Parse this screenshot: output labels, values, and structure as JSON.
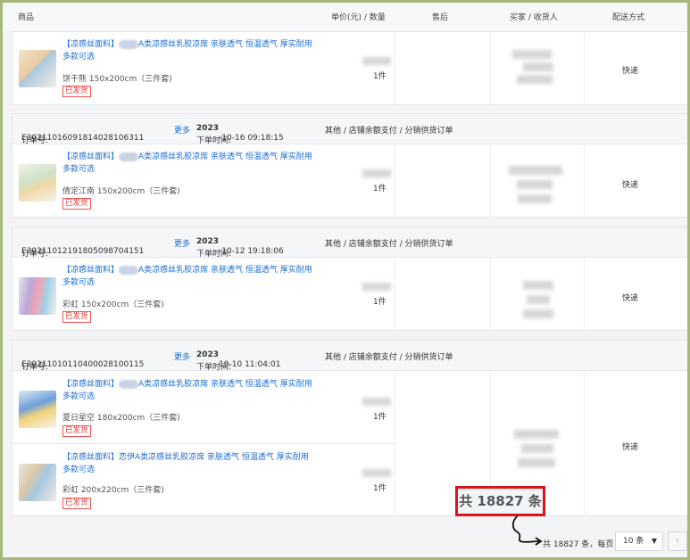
{
  "table_header": {
    "product": "商品",
    "price_qty": "单价(元) / 数量",
    "after_sale": "售后",
    "buyer": "买家 / 收货人",
    "shipping": "配送方式"
  },
  "labels": {
    "order_no": "订单号:",
    "more": "更多",
    "order_time": "下单时间:"
  },
  "orders": [
    {
      "order_no": "",
      "time_year": "",
      "time_rest": "",
      "info": "",
      "shipping": "快递",
      "items": [
        {
          "title_prefix": "【凉感丝面料】",
          "title_suffix": "A类凉感丝乳胶凉席 亲肤透气 恒温透气 厚实耐用 多款可选",
          "variant": "饼干熊 150x200cm（三件套)",
          "status": "已发货",
          "qty": "1件"
        }
      ]
    },
    {
      "order_no": "E20211016091814028106311",
      "time_year": "2023",
      "time_rest": "-10-16 09:18:15",
      "info": "其他 / 店铺余额支付 / 分销供货订单",
      "shipping": "快递",
      "items": [
        {
          "title_prefix": "【凉感丝面料】",
          "title_suffix": "A类凉感丝乳胶凉席 亲肤透气 恒温透气 厚实耐用 多款可选",
          "variant": "倩定江南 150x200cm（三件套)",
          "status": "已发货",
          "qty": "1件"
        }
      ]
    },
    {
      "order_no": "E20211012191805098704151",
      "time_year": "2023",
      "time_rest": "-10-12 19:18:06",
      "info": "其他 / 店铺余额支付 / 分销供货订单",
      "shipping": "快递",
      "items": [
        {
          "title_prefix": "【凉感丝面料】",
          "title_suffix": "A类凉感丝乳胶凉席 亲肤透气 恒温透气 厚实耐用 多款可选",
          "variant": "彩虹 150x200cm（三件套)",
          "status": "已发货",
          "qty": "1件"
        }
      ]
    },
    {
      "order_no": "E20211010110400028100115",
      "time_year": "2023",
      "time_rest": "10-10 11:04:01",
      "info": "其他 / 店铺余额支付 / 分销供货订单",
      "shipping": "快递",
      "items": [
        {
          "title_prefix": "【凉感丝面料】",
          "title_suffix": "A类凉感丝乳胶凉席 亲肤透气 恒温透气 厚实耐用 多款可选",
          "variant": "夏日星空 180x200cm（三件套)",
          "status": "已发货",
          "qty": "1件"
        },
        {
          "title_prefix": "【凉感丝面料】",
          "title_suffix": "恋伊A类凉感丝乳胶凉席 亲肤透气 恒温透气 厚实耐用 多款可选",
          "variant": "彩虹 200x220cm（三件套)",
          "status": "已发货",
          "qty": "1件"
        }
      ]
    }
  ],
  "footer": {
    "total_highlight": "共 18827 条",
    "pager_text": "共 18827 条，每页",
    "page_size": "10 条",
    "prev": "‹"
  },
  "colors": {
    "link": "#1a6dd4",
    "status_red": "#e33333",
    "highlight_border": "#d9151b"
  }
}
